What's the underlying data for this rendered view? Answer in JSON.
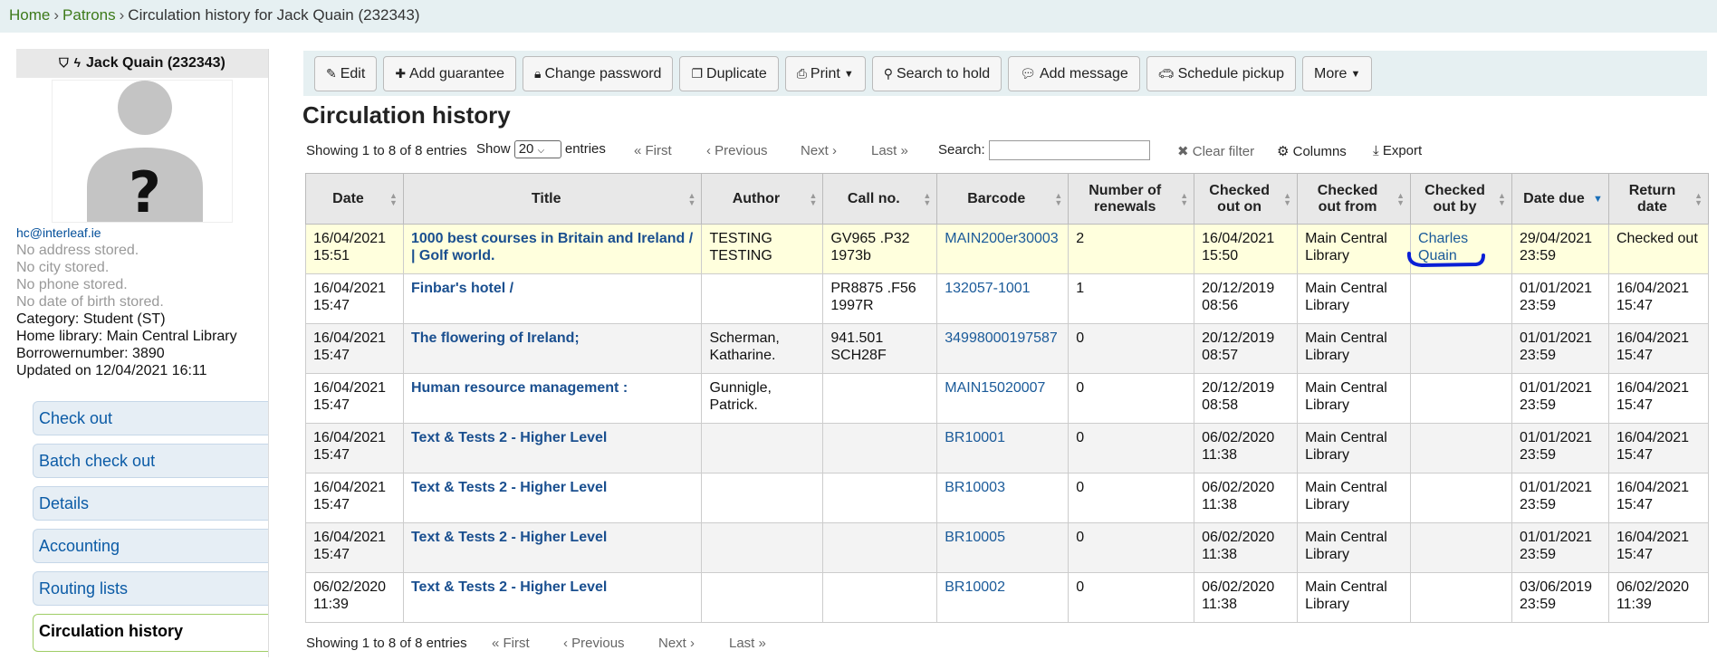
{
  "breadcrumb": {
    "home": "Home",
    "patrons": "Patrons",
    "current": "Circulation history for Jack Quain (232343)"
  },
  "patron": {
    "header": "Jack Quain (232343)",
    "email": "hc@interleaf.ie",
    "no_address": "No address stored.",
    "no_city": "No city stored.",
    "no_phone": "No phone stored.",
    "no_dob": "No date of birth stored.",
    "category": "Category: Student (ST)",
    "home_library": "Home library: Main Central Library",
    "borrowernumber": "Borrowernumber: 3890",
    "updated": "Updated on 12/04/2021 16:11"
  },
  "nav": {
    "checkout": "Check out",
    "batch_checkout": "Batch check out",
    "details": "Details",
    "accounting": "Accounting",
    "routing_lists": "Routing lists",
    "circ_history": "Circulation history"
  },
  "toolbar": {
    "edit": "Edit",
    "add_guarantee": "Add guarantee",
    "change_password": "Change password",
    "duplicate": "Duplicate",
    "print": "Print",
    "search_to_hold": "Search to hold",
    "add_message": "Add message",
    "schedule_pickup": "Schedule pickup",
    "more": "More"
  },
  "page_title": "Circulation history",
  "controls": {
    "showing": "Showing 1 to 8 of 8 entries",
    "show": "Show",
    "show_value": "20",
    "entries": "entries",
    "first": "First",
    "previous": "Previous",
    "next": "Next",
    "last": "Last",
    "search": "Search:",
    "clear_filter": "Clear filter",
    "columns": "Columns",
    "export": "Export"
  },
  "columns": {
    "date": "Date",
    "title": "Title",
    "author": "Author",
    "callno": "Call no.",
    "barcode": "Barcode",
    "renewals": "Number of renewals",
    "checked_out_on": "Checked out on",
    "checked_out_from": "Checked out from",
    "checked_out_by": "Checked out by",
    "date_due": "Date due",
    "return_date": "Return date"
  },
  "rows": [
    {
      "date": "16/04/2021 15:51",
      "title": "1000 best courses in Britain and Ireland / | Golf world.",
      "author": "TESTING TESTING",
      "callno": "GV965 .P32 1973b",
      "barcode": "MAIN200er30003",
      "renewals": "2",
      "out_on": "16/04/2021 15:50",
      "out_from": "Main Central Library",
      "out_by": "Charles Quain",
      "due": "29/04/2021 23:59",
      "returned": "Checked out"
    },
    {
      "date": "16/04/2021 15:47",
      "title": "Finbar's hotel /",
      "author": "",
      "callno": "PR8875 .F56 1997R",
      "barcode": "132057-1001",
      "renewals": "1",
      "out_on": "20/12/2019 08:56",
      "out_from": "Main Central Library",
      "out_by": "",
      "due": "01/01/2021 23:59",
      "returned": "16/04/2021 15:47"
    },
    {
      "date": "16/04/2021 15:47",
      "title": "The flowering of Ireland;",
      "author": "Scherman, Katharine.",
      "callno": "941.501 SCH28F",
      "barcode": "34998000197587",
      "renewals": "0",
      "out_on": "20/12/2019 08:57",
      "out_from": "Main Central Library",
      "out_by": "",
      "due": "01/01/2021 23:59",
      "returned": "16/04/2021 15:47"
    },
    {
      "date": "16/04/2021 15:47",
      "title": "Human resource management :",
      "author": "Gunnigle, Patrick.",
      "callno": "",
      "barcode": "MAIN15020007",
      "renewals": "0",
      "out_on": "20/12/2019 08:58",
      "out_from": "Main Central Library",
      "out_by": "",
      "due": "01/01/2021 23:59",
      "returned": "16/04/2021 15:47"
    },
    {
      "date": "16/04/2021 15:47",
      "title": "Text & Tests 2 - Higher Level",
      "author": "",
      "callno": "",
      "barcode": "BR10001",
      "renewals": "0",
      "out_on": "06/02/2020 11:38",
      "out_from": "Main Central Library",
      "out_by": "",
      "due": "01/01/2021 23:59",
      "returned": "16/04/2021 15:47"
    },
    {
      "date": "16/04/2021 15:47",
      "title": "Text & Tests 2 - Higher Level",
      "author": "",
      "callno": "",
      "barcode": "BR10003",
      "renewals": "0",
      "out_on": "06/02/2020 11:38",
      "out_from": "Main Central Library",
      "out_by": "",
      "due": "01/01/2021 23:59",
      "returned": "16/04/2021 15:47"
    },
    {
      "date": "16/04/2021 15:47",
      "title": "Text & Tests 2 - Higher Level",
      "author": "",
      "callno": "",
      "barcode": "BR10005",
      "renewals": "0",
      "out_on": "06/02/2020 11:38",
      "out_from": "Main Central Library",
      "out_by": "",
      "due": "01/01/2021 23:59",
      "returned": "16/04/2021 15:47"
    },
    {
      "date": "06/02/2020 11:39",
      "title": "Text & Tests 2 - Higher Level",
      "author": "",
      "callno": "",
      "barcode": "BR10002",
      "renewals": "0",
      "out_on": "06/02/2020 11:38",
      "out_from": "Main Central Library",
      "out_by": "",
      "due": "03/06/2019 23:59",
      "returned": "06/02/2020 11:39"
    }
  ],
  "colors": {
    "breadcrumb_bg": "#e6f0f2",
    "link": "#1a5a99",
    "highlight_row": "#ffffdd",
    "annotation": "#0a1fd6"
  },
  "icons": {
    "edit": "pencil-icon",
    "add_guarantee": "plus-icon",
    "change_password": "lock-icon",
    "duplicate": "copy-icon",
    "print": "printer-icon",
    "search_to_hold": "search-icon",
    "add_message": "comment-icon",
    "schedule_pickup": "car-icon",
    "clear_filter": "close-icon",
    "columns": "gear-icon",
    "export": "download-icon"
  }
}
